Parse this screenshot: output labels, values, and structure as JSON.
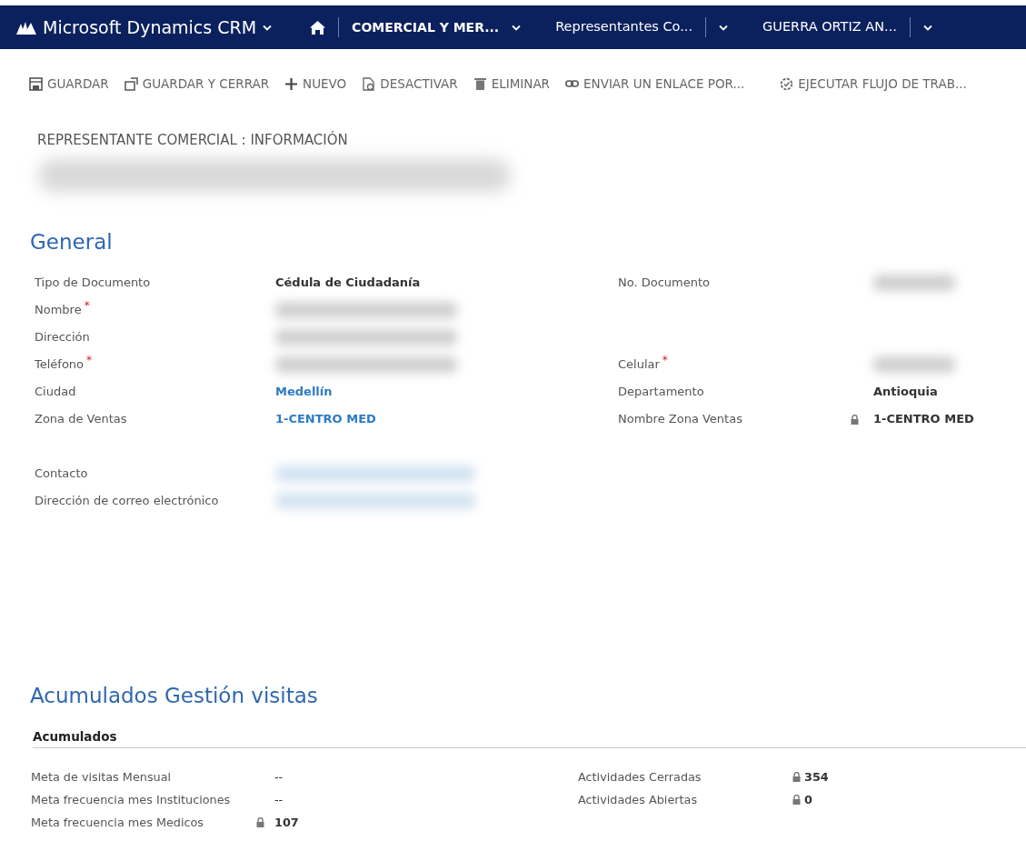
{
  "navbar": {
    "app_title": "Microsoft Dynamics CRM",
    "breadcrumbs": [
      {
        "label": "COMERCIAL Y MER...",
        "strong": true,
        "divider_before": true,
        "divider_after": false
      },
      {
        "label": "Representantes Co...",
        "strong": false,
        "divider_before": false,
        "divider_after": true
      },
      {
        "label": "GUERRA ORTIZ AN...",
        "strong": false,
        "divider_before": false,
        "divider_after": true
      }
    ]
  },
  "toolbar": [
    {
      "label": "GUARDAR"
    },
    {
      "label": "GUARDAR Y CERRAR"
    },
    {
      "label": "NUEVO"
    },
    {
      "label": "DESACTIVAR"
    },
    {
      "label": "ELIMINAR"
    },
    {
      "label": "ENVIAR UN ENLACE POR..."
    },
    {
      "label": "EJECUTAR FLUJO DE TRAB..."
    }
  ],
  "form_header": {
    "entity": "REPRESENTANTE COMERCIAL : INFORMACIÓN",
    "record_title_redacted": true
  },
  "general": {
    "title": "General",
    "groups": [
      [
        {
          "left": {
            "label": "Tipo de Documento",
            "kind": "text",
            "value": "Cédula de Ciudadanía"
          },
          "right": {
            "label": "No. Documento",
            "kind": "redacted",
            "locked": false
          }
        },
        {
          "left": {
            "label": "Nombre",
            "required_mark": "*",
            "kind": "redacted"
          }
        },
        {
          "left": {
            "label": "Dirección",
            "kind": "redacted"
          }
        },
        {
          "left": {
            "label": "Teléfono",
            "required_mark": "*",
            "kind": "redacted"
          },
          "right": {
            "label": "Celular",
            "required_mark": "*",
            "kind": "redacted",
            "locked": false
          }
        },
        {
          "left": {
            "label": "Ciudad",
            "kind": "link",
            "value": "Medellín"
          },
          "right": {
            "label": "Departamento",
            "kind": "text",
            "value": "Antioquia",
            "locked": false
          }
        },
        {
          "left": {
            "label": "Zona de Ventas",
            "kind": "link",
            "value": "1-CENTRO MED"
          },
          "right": {
            "label": "Nombre Zona Ventas",
            "kind": "text",
            "value": "1-CENTRO MED",
            "locked": true
          }
        }
      ],
      [
        {
          "left": {
            "label": "Contacto",
            "kind": "redacted-link"
          }
        },
        {
          "left": {
            "label": "Dirección de correo electrónico",
            "kind": "redacted-link"
          }
        }
      ]
    ]
  },
  "accumulated": {
    "title": "Acumulados Gestión visitas",
    "subtitle": "Acumulados",
    "rows": [
      {
        "left": {
          "label": "Meta de visitas Mensual",
          "value": "--",
          "locked": false
        },
        "right": {
          "label": "Actividades Cerradas",
          "value": "354",
          "locked": true
        }
      },
      {
        "left": {
          "label": "Meta frecuencia mes Instituciones",
          "value": "--",
          "locked": false
        },
        "right": {
          "label": "Actividades Abiertas",
          "value": "0",
          "locked": true
        }
      },
      {
        "left": {
          "label": "Meta frecuencia mes Medicos",
          "value": "107",
          "locked": true
        }
      }
    ]
  }
}
